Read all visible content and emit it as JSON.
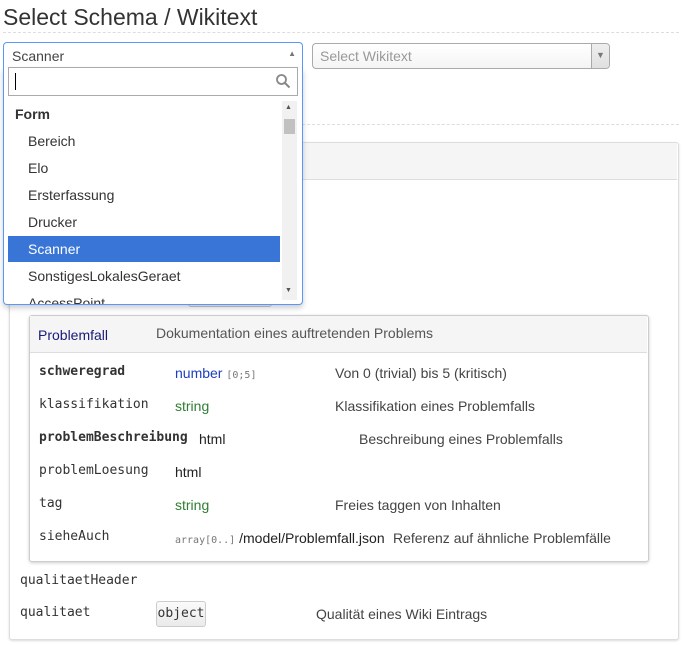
{
  "page": {
    "title": "Select Schema / Wikitext"
  },
  "schema_select": {
    "selected": "Scanner",
    "search_value": "",
    "group_label": "Form",
    "options": [
      "Bereich",
      "Elo",
      "Ersterfassung",
      "Drucker",
      "Scanner",
      "SonstigesLokalesGeraet",
      "AccessPoint"
    ],
    "highlighted": "Scanner"
  },
  "wikitext_select": {
    "placeholder": "Select Wikitext"
  },
  "subpanel": {
    "title": "Problemfall",
    "description": "Dokumentation eines auftretenden Problems",
    "rows": [
      {
        "name": "schweregrad",
        "bold": true,
        "type": "number",
        "constraint": "[0;5]",
        "description": "Von 0 (trivial) bis 5 (kritisch)"
      },
      {
        "name": "klassifikation",
        "bold": false,
        "type": "string",
        "constraint": "",
        "description": "Klassifikation eines Problemfalls"
      },
      {
        "name": "problemBeschreibung",
        "bold": true,
        "type": "html",
        "constraint": "",
        "description": "Beschreibung eines Problemfalls"
      },
      {
        "name": "problemLoesung",
        "bold": false,
        "type": "html",
        "constraint": "",
        "description": ""
      },
      {
        "name": "tag",
        "bold": false,
        "type": "string",
        "constraint": "",
        "description": "Freies taggen von Inhalten"
      },
      {
        "name": "sieheAuch",
        "bold": false,
        "type": "/model/Problemfall.json",
        "constraint": "array[0..]",
        "description": "Referenz auf ähnliche Problemfälle"
      }
    ]
  },
  "outer_fields": {
    "header_field": "qualitaetHeader",
    "field_name": "qualitaet",
    "field_type": "object",
    "field_description": "Qualität eines Wiki Eintrags"
  },
  "colors": {
    "highlight": "#3875d7",
    "focus_border": "#5897fb",
    "type_number": "#1a3fbf",
    "type_string": "#2e7d32"
  }
}
